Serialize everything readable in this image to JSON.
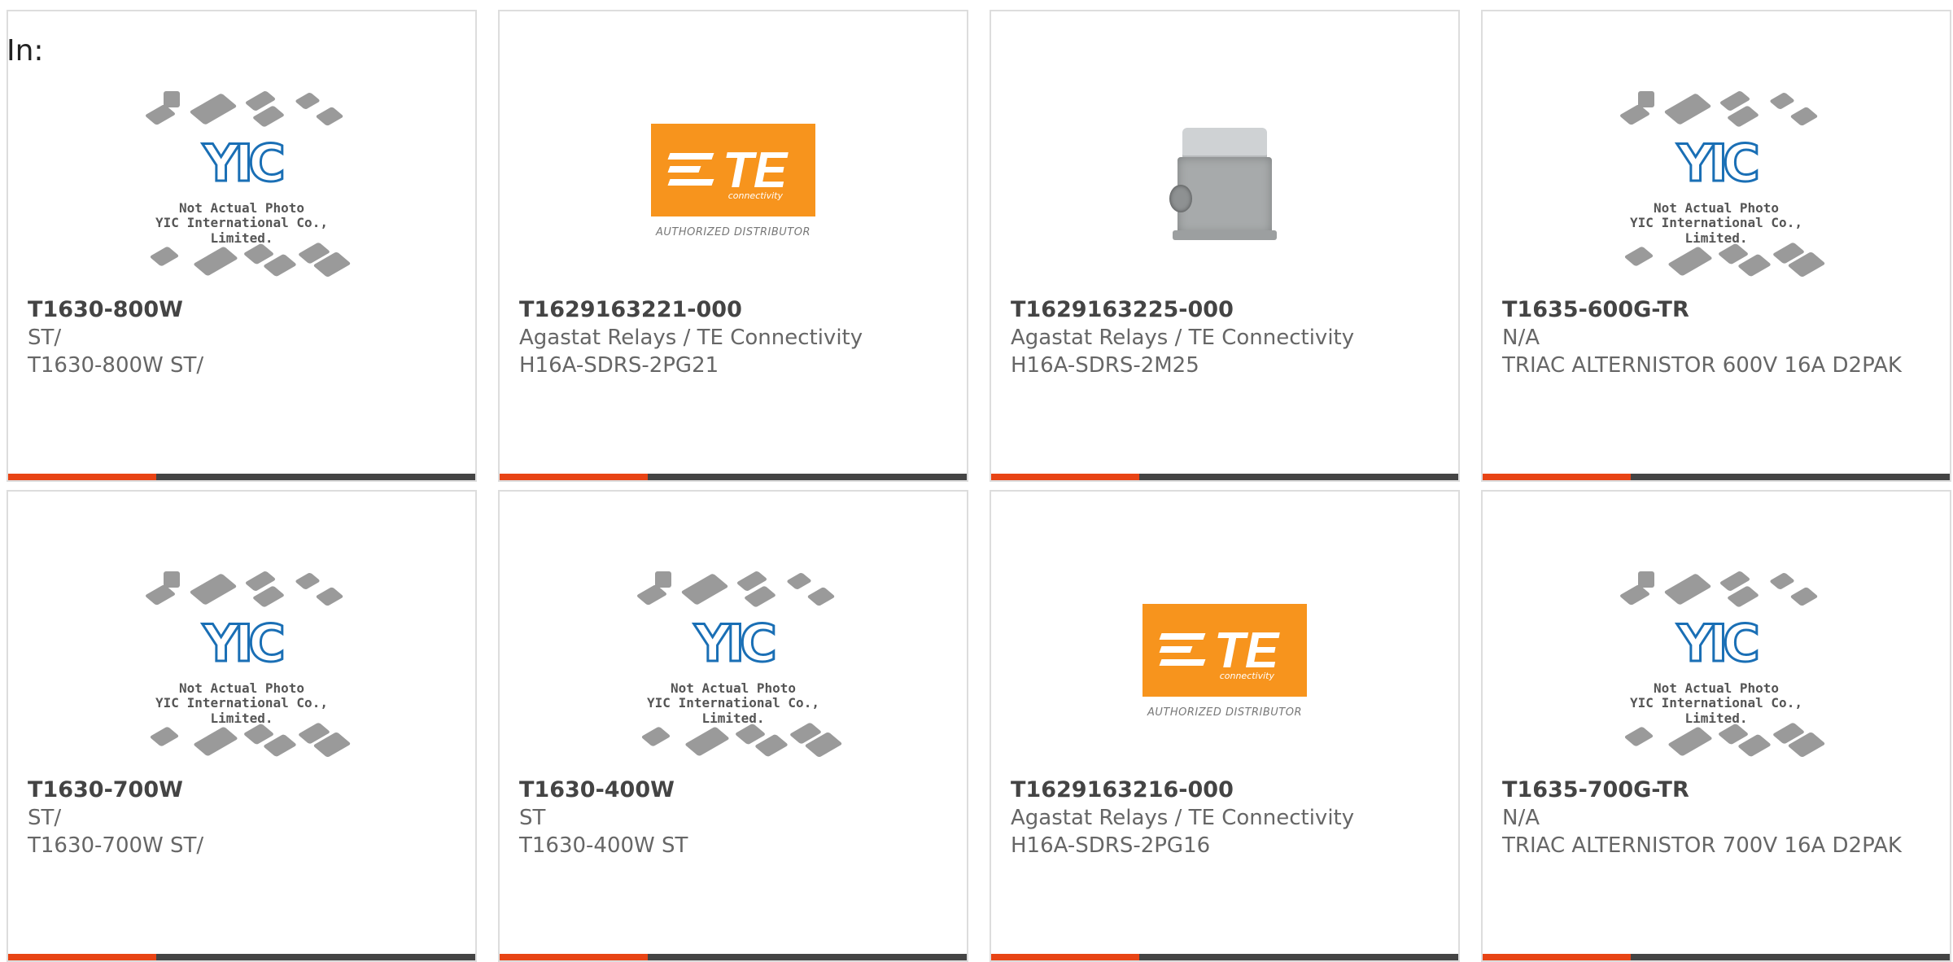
{
  "header": {
    "in_label": "In:"
  },
  "placeholder": {
    "brand": "YIC",
    "caption1": "Not Actual Photo",
    "caption2": "YIC International Co., Limited."
  },
  "te_logo": {
    "word": "TE",
    "connectivity": "connectivity",
    "authorized": "AUTHORIZED DISTRIBUTOR"
  },
  "colors": {
    "accent": "#e84415",
    "bar": "#444444",
    "te_orange": "#f7941d",
    "yic_blue": "#1a6fb5"
  },
  "products": [
    {
      "part": "T1630-800W",
      "maker": "ST/",
      "desc": "T1630-800W ST/",
      "image": "yic-placeholder"
    },
    {
      "part": "T1629163221-000",
      "maker": "Agastat Relays / TE Connectivity",
      "desc": "H16A-SDRS-2PG21",
      "image": "te-logo"
    },
    {
      "part": "T1629163225-000",
      "maker": "Agastat Relays / TE Connectivity",
      "desc": "H16A-SDRS-2M25",
      "image": "connector-photo"
    },
    {
      "part": "T1635-600G-TR",
      "maker": "N/A",
      "desc": "TRIAC ALTERNISTOR 600V 16A D2PAK",
      "image": "yic-placeholder"
    },
    {
      "part": "T1630-700W",
      "maker": "ST/",
      "desc": "T1630-700W ST/",
      "image": "yic-placeholder"
    },
    {
      "part": "T1630-400W",
      "maker": "ST",
      "desc": "T1630-400W ST",
      "image": "yic-placeholder"
    },
    {
      "part": "T1629163216-000",
      "maker": "Agastat Relays / TE Connectivity",
      "desc": "H16A-SDRS-2PG16",
      "image": "te-logo"
    },
    {
      "part": "T1635-700G-TR",
      "maker": "N/A",
      "desc": "TRIAC ALTERNISTOR 700V 16A D2PAK",
      "image": "yic-placeholder"
    }
  ]
}
